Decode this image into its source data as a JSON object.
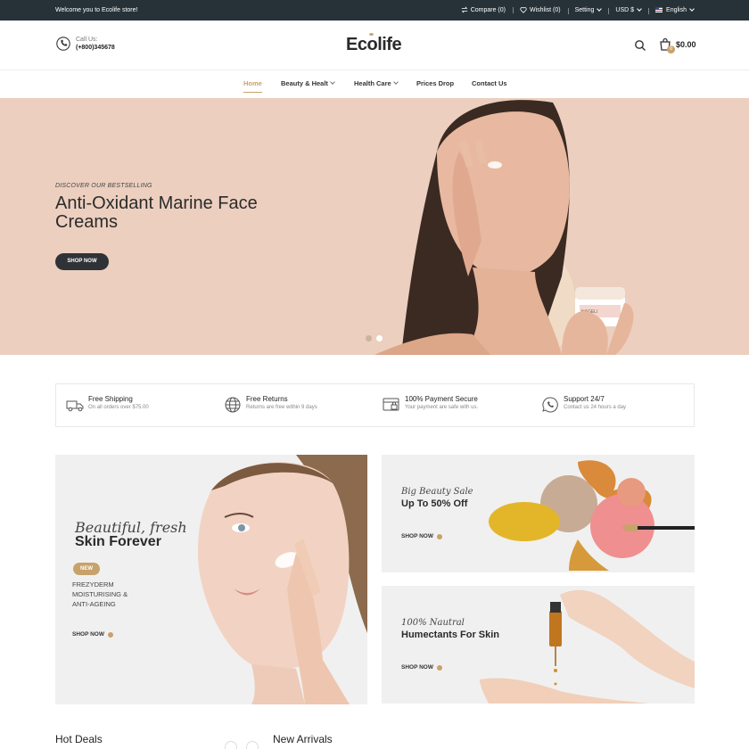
{
  "topbar": {
    "welcome": "Welcome you to Ecolife store!",
    "compare": "Compare (0)",
    "wishlist": "Wishlist (0)",
    "setting": "Setting",
    "currency": "USD $",
    "language": "English"
  },
  "header": {
    "call_label": "Call Us:",
    "phone": "(+800)345678",
    "logo_prefix": "Ec",
    "logo_o": "o",
    "logo_suffix": "life",
    "cart_count": "0",
    "cart_total": "$0.00"
  },
  "nav": {
    "items": [
      "Home",
      "Beauty & Healt",
      "Health Care",
      "Prices Drop",
      "Contact Us"
    ]
  },
  "hero": {
    "kicker": "DISCOVER OUR BESTSELLING",
    "title": "Anti-Oxidant Marine Face Creams",
    "button": "SHOP NOW",
    "jar_label": "NAGELI"
  },
  "features": [
    {
      "title": "Free Shipping",
      "sub": "On all orders over $75.00",
      "icon": "truck-icon"
    },
    {
      "title": "Free Returns",
      "sub": "Returns are free within 9 days",
      "icon": "globe-icon"
    },
    {
      "title": "100% Payment Secure",
      "sub": "Your payment are safe with us.",
      "icon": "payment-icon"
    },
    {
      "title": "Support 24/7",
      "sub": "Contact us 24 hours a day",
      "icon": "support-icon"
    }
  ],
  "banners": {
    "left": {
      "line1": "Beautiful, fresh",
      "line2": "Skin Forever",
      "badge": "NEW",
      "desc1": "FREZYDERM",
      "desc2": "MOISTURISING &",
      "desc3": "ANTI-AGEING",
      "button": "SHOP NOW"
    },
    "right_top": {
      "line1": "Big Beauty Sale",
      "line2": "Up To 50% Off",
      "button": "SHOP NOW"
    },
    "right_bottom": {
      "line1": "100% Nautral",
      "line2": "Humectants For Skin",
      "button": "SHOP NOW"
    }
  },
  "sections": {
    "hot_deals": "Hot Deals",
    "new_arrivals": "New Arrivals"
  },
  "colors": {
    "accent": "#c8a26b",
    "topbar": "#263238",
    "hero_bg": "#eccfbf"
  }
}
